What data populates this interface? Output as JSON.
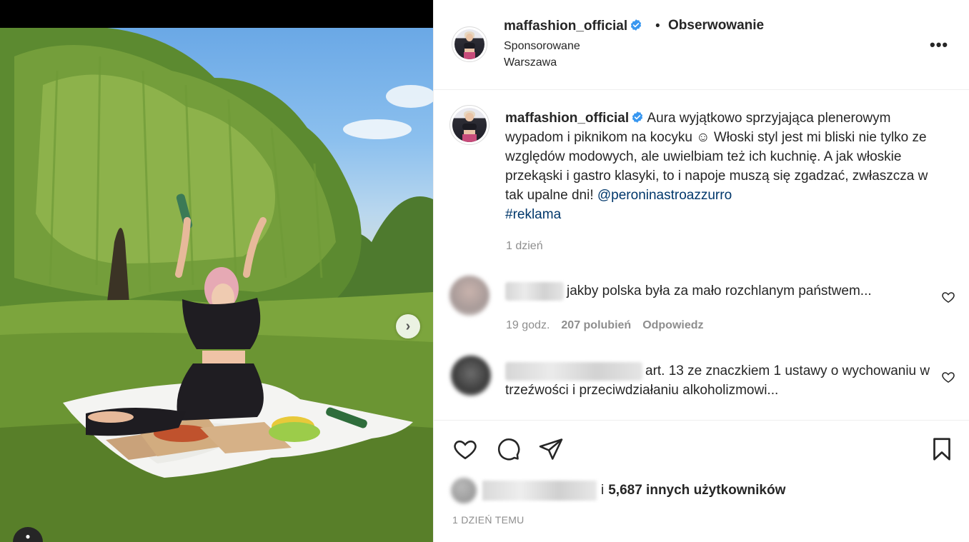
{
  "post": {
    "username": "maffashion_official",
    "follow_separator": "•",
    "follow_label": "Obserwowanie",
    "sponsored": "Sponsorowane",
    "location": "Warszawa",
    "more_label": "•••"
  },
  "caption": {
    "username": "maffashion_official",
    "text": "Aura wyjątkowo sprzyjająca plenerowym wypadom i piknikom na kocyku ☺ Włoski styl jest mi bliski nie tylko ze względów modowych, ale uwielbiam też ich kuchnię. A jak włoskie przekąski i gastro klasyki, to i napoje muszą się zgadzać, zwłaszcza w tak upalne dni! ",
    "mention": "@peroninastroazzurro",
    "hashtag": "#reklama",
    "time": "1 dzień"
  },
  "comments": [
    {
      "text": "jakby polska była za mało rozchlanym państwem...",
      "time": "19 godz.",
      "likes": "207 polubień",
      "reply": "Odpowiedz"
    },
    {
      "text": "art. 13 ze znaczkiem 1 ustawy o wychowaniu w trzeźwości i przeciwdziałaniu alkoholizmowi..."
    }
  ],
  "footer": {
    "likes_conjunction": "i",
    "likes_others": "5,687 innych użytkowników",
    "time_ago": "1 DZIEŃ TEMU"
  },
  "media": {
    "next_label": "›",
    "tag_label": "●"
  },
  "colors": {
    "link": "#00376b",
    "secondary": "#8e8e8e",
    "verified": "#3897f0",
    "primary": "#262626"
  },
  "icons": [
    "verified-badge-icon",
    "more-options-icon",
    "heart-icon",
    "comment-icon",
    "share-icon",
    "bookmark-icon",
    "next-arrow-icon",
    "user-tag-icon"
  ]
}
